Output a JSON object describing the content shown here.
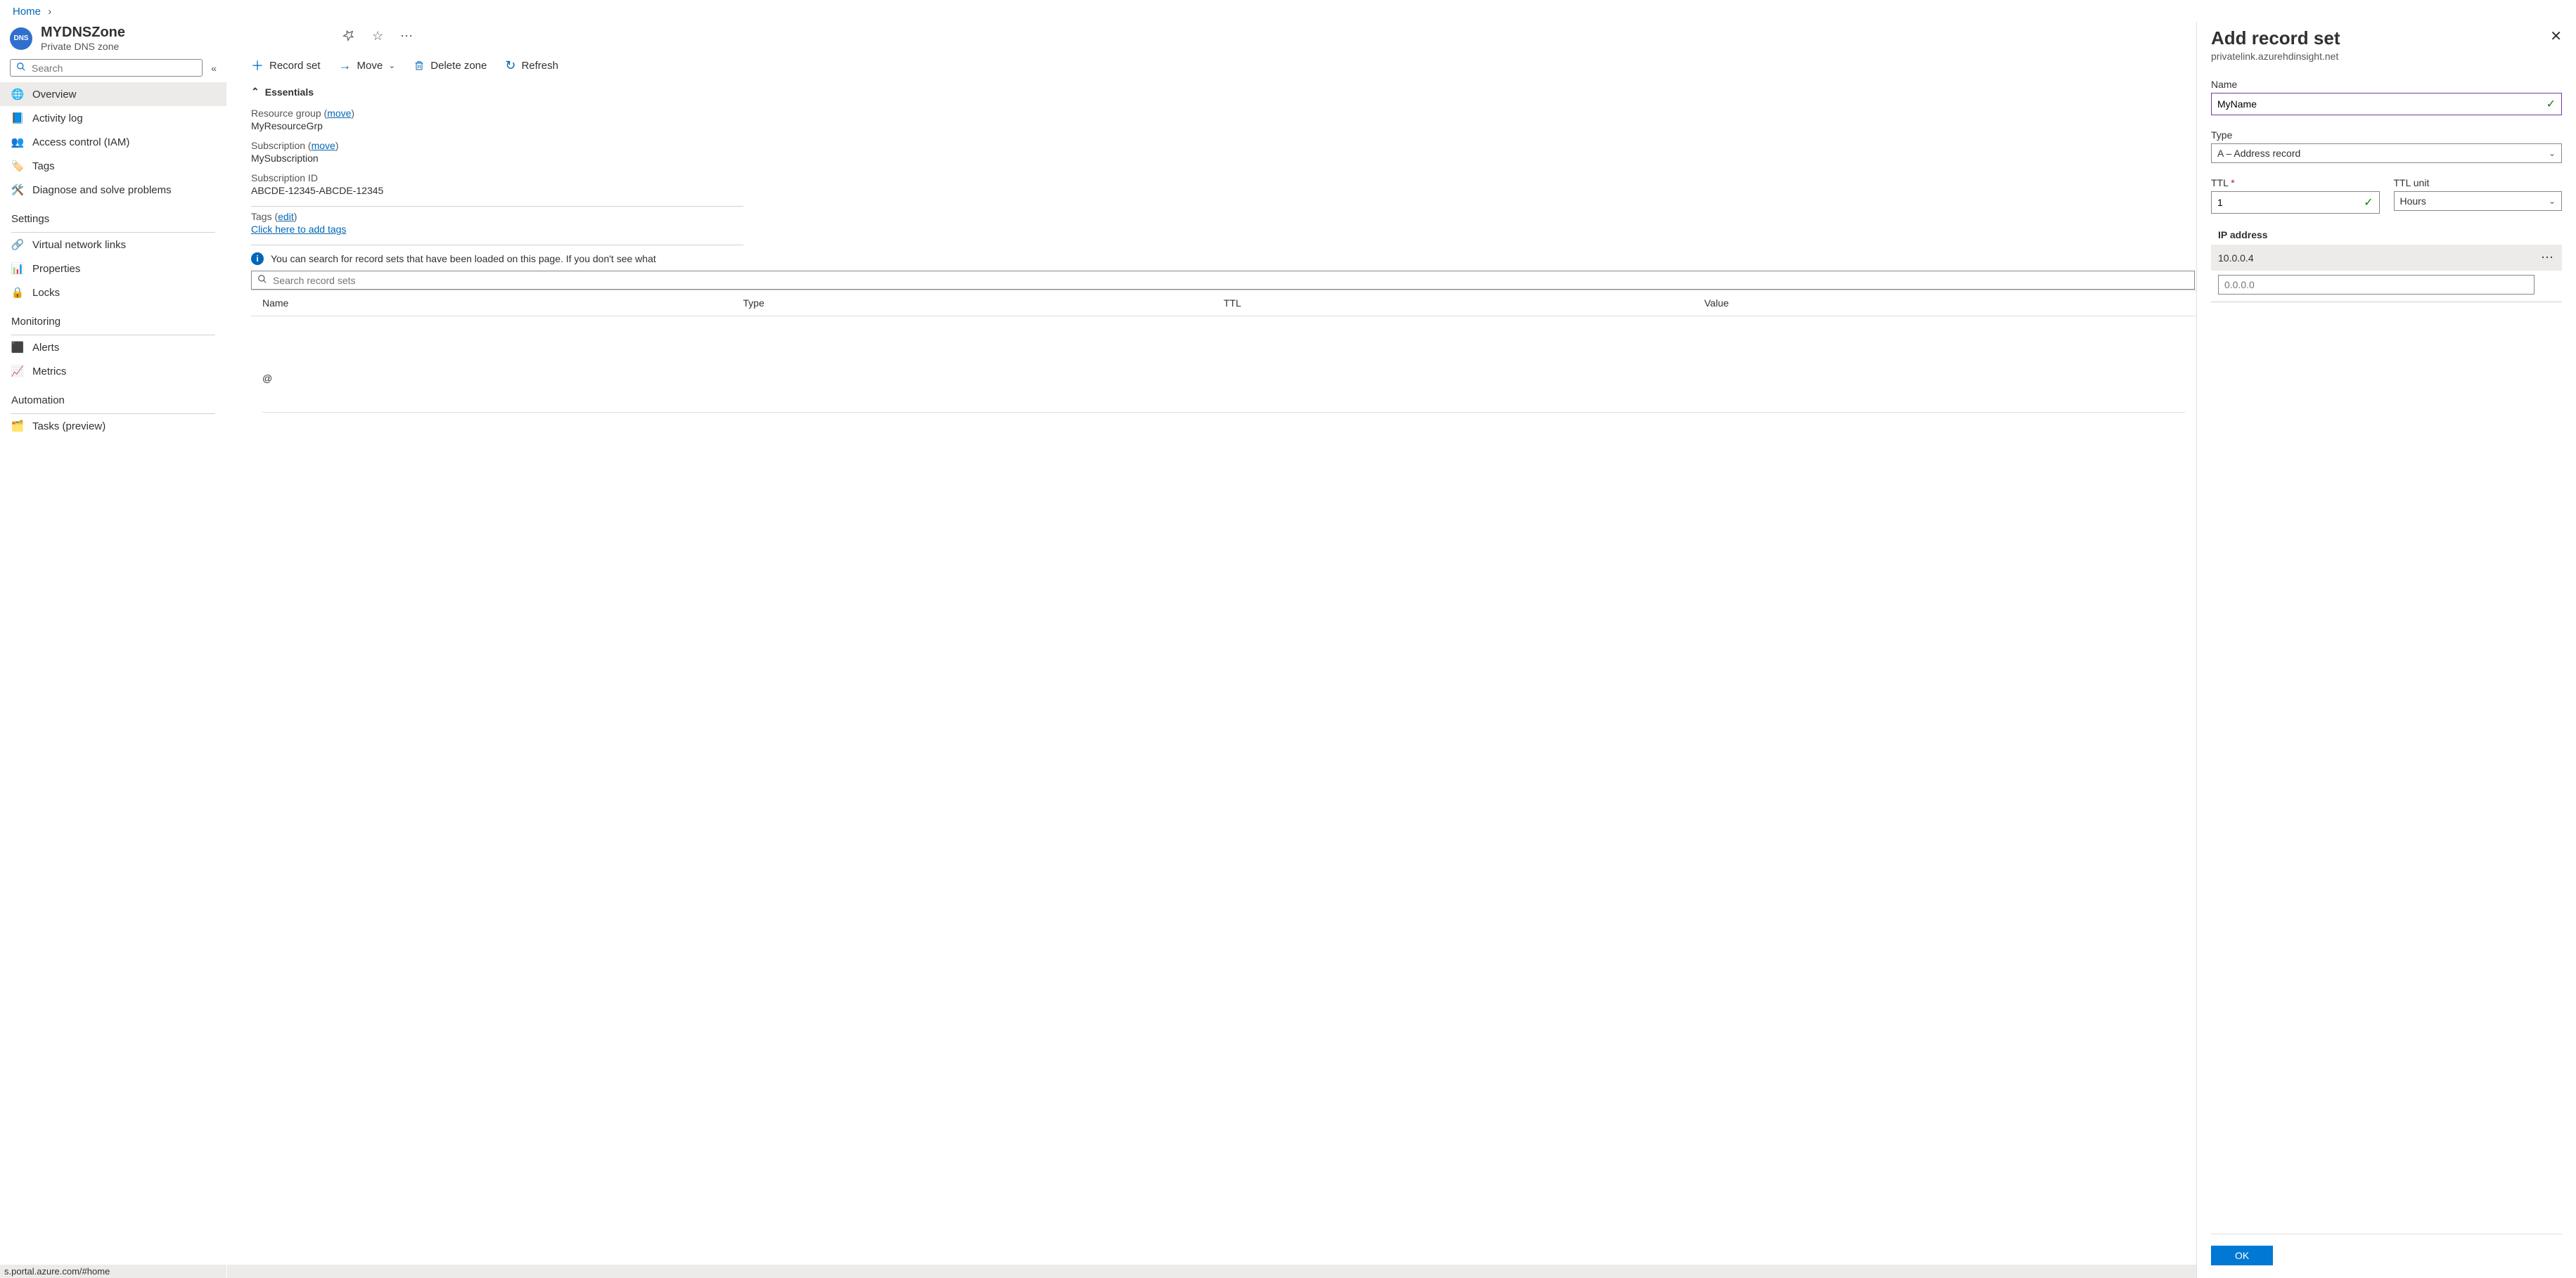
{
  "breadcrumb": {
    "home": "Home"
  },
  "resource": {
    "name": "MYDNSZone",
    "kind": "Private DNS zone",
    "badge": "DNS"
  },
  "sidebar": {
    "search_placeholder": "Search",
    "items": [
      {
        "label": "Overview",
        "icon": "globe",
        "selected": true
      },
      {
        "label": "Activity log",
        "icon": "log"
      },
      {
        "label": "Access control (IAM)",
        "icon": "iam"
      },
      {
        "label": "Tags",
        "icon": "tag"
      },
      {
        "label": "Diagnose and solve problems",
        "icon": "wrench"
      }
    ],
    "sections": {
      "settings": "Settings",
      "settings_items": [
        {
          "label": "Virtual network links",
          "icon": "vnet"
        },
        {
          "label": "Properties",
          "icon": "props"
        },
        {
          "label": "Locks",
          "icon": "lock"
        }
      ],
      "monitoring": "Monitoring",
      "monitoring_items": [
        {
          "label": "Alerts",
          "icon": "alert"
        },
        {
          "label": "Metrics",
          "icon": "metrics"
        }
      ],
      "automation": "Automation",
      "automation_items": [
        {
          "label": "Tasks (preview)",
          "icon": "tasks"
        }
      ]
    }
  },
  "status_url": "s.portal.azure.com/#home",
  "toolbar": {
    "record_set": "Record set",
    "move": "Move",
    "delete_zone": "Delete zone",
    "refresh": "Refresh"
  },
  "essentials": {
    "header": "Essentials",
    "resource_group_label": "Resource group",
    "resource_group_move": "move",
    "resource_group_value": "MyResourceGrp",
    "subscription_label": "Subscription",
    "subscription_move": "move",
    "subscription_value": "MySubscription",
    "subscription_id_label": "Subscription ID",
    "subscription_id_value": "ABCDE-12345-ABCDE-12345",
    "tags_label": "Tags",
    "tags_edit": "edit",
    "tags_add": "Click here to add tags"
  },
  "info_banner": "You can search for record sets that have been loaded on this page. If you don't see what",
  "record_search_placeholder": "Search record sets",
  "records": {
    "headers": {
      "name": "Name",
      "type": "Type",
      "ttl": "TTL",
      "value": "Value"
    },
    "row0_name": "@"
  },
  "panel": {
    "title": "Add record set",
    "subtitle": "privatelink.azurehdinsight.net",
    "name_label": "Name",
    "name_value": "MyName",
    "type_label": "Type",
    "type_value": "A – Address record",
    "ttl_label": "TTL",
    "ttl_value": "1",
    "ttl_unit_label": "TTL unit",
    "ttl_unit_value": "Hours",
    "ip_header": "IP address",
    "ip_existing": "10.0.0.4",
    "ip_placeholder": "0.0.0.0",
    "ok": "OK"
  }
}
